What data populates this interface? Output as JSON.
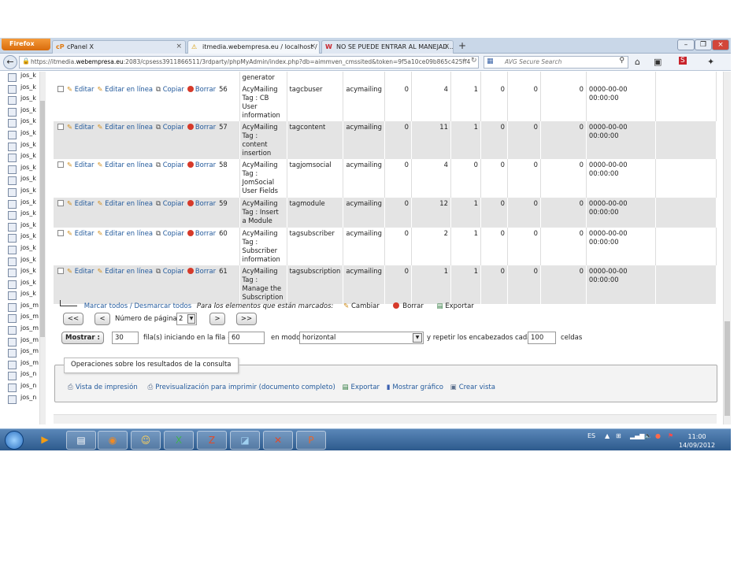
{
  "browser": {
    "menu_label": "Firefox",
    "tabs": [
      {
        "icon": "cP",
        "label": "cPanel X"
      },
      {
        "icon": "⚠",
        "label": "itmedia.webempresa.eu / localhost / ..."
      },
      {
        "icon": "W",
        "label": "NO SE PUEDE ENTRAR AL MANEJAD..."
      }
    ],
    "new_tab": "+",
    "url_prefix": "https://itmedia.",
    "url_domain": "webempresa.eu",
    "url_rest": ":2083/cpsess3911866511/3rdparty/phpMyAdmin/index.php?db=aimmven_cmssited&token=9f5a10ce09b865c425ff4",
    "search_placeholder": "AVG Secure Search"
  },
  "sidebar": {
    "items": [
      "jos_k",
      "jos_k",
      "jos_k",
      "jos_k",
      "jos_k",
      "jos_k",
      "jos_k",
      "jos_k",
      "jos_k",
      "jos_k",
      "jos_k",
      "jos_k",
      "jos_k",
      "jos_k",
      "jos_k",
      "jos_k",
      "jos_k",
      "jos_k",
      "jos_k",
      "jos_k",
      "jos_m",
      "jos_m",
      "jos_m",
      "jos_m",
      "jos_m",
      "jos_m",
      "jos_n",
      "jos_n",
      "jos_n"
    ]
  },
  "actions": {
    "edit": "Editar",
    "inline": "Editar en línea",
    "copy": "Copiar",
    "delete": "Borrar"
  },
  "top_partial": "generator",
  "rows": [
    {
      "id": "56",
      "name": "AcyMailing Tag : CB User information",
      "element": "tagcbuser",
      "folder": "acymailing",
      "c1": "0",
      "c2": "4",
      "c3": "1",
      "c4": "0",
      "c5": "0",
      "c6": "0",
      "date": "0000-00-00 00:00:00"
    },
    {
      "id": "57",
      "name": "AcyMailing Tag : content insertion",
      "element": "tagcontent",
      "folder": "acymailing",
      "c1": "0",
      "c2": "11",
      "c3": "1",
      "c4": "0",
      "c5": "0",
      "c6": "0",
      "date": "0000-00-00 00:00:00"
    },
    {
      "id": "58",
      "name": "AcyMailing Tag : JomSocial User Fields",
      "element": "tagjomsocial",
      "folder": "acymailing",
      "c1": "0",
      "c2": "4",
      "c3": "0",
      "c4": "0",
      "c5": "0",
      "c6": "0",
      "date": "0000-00-00 00:00:00"
    },
    {
      "id": "59",
      "name": "AcyMailing Tag : Insert a Module",
      "element": "tagmodule",
      "folder": "acymailing",
      "c1": "0",
      "c2": "12",
      "c3": "1",
      "c4": "0",
      "c5": "0",
      "c6": "0",
      "date": "0000-00-00 00:00:00"
    },
    {
      "id": "60",
      "name": "AcyMailing Tag : Subscriber information",
      "element": "tagsubscriber",
      "folder": "acymailing",
      "c1": "0",
      "c2": "2",
      "c3": "1",
      "c4": "0",
      "c5": "0",
      "c6": "0",
      "date": "0000-00-00 00:00:00"
    },
    {
      "id": "61",
      "name": "AcyMailing Tag : Manage the Subscription",
      "element": "tagsubscription",
      "folder": "acymailing",
      "c1": "0",
      "c2": "1",
      "c3": "1",
      "c4": "0",
      "c5": "0",
      "c6": "0",
      "date": "0000-00-00 00:00:00"
    }
  ],
  "bulk": {
    "check_all": "Marcar todos",
    "sep": " / ",
    "uncheck_all": "Desmarcar todos",
    "for_selected": "Para los elementos que están marcados:",
    "change": "Cambiar",
    "delete": "Borrar",
    "export": "Exportar"
  },
  "pager": {
    "first": "<<",
    "prev": "<",
    "page_label": "Número de página:",
    "page_value": "2",
    "next": ">",
    "last": ">>"
  },
  "show": {
    "button": "Mostrar :",
    "rows_value": "30",
    "rows_label": "fila(s) iniciando en la fila #",
    "start_value": "60",
    "mode_label": "en modo",
    "mode_value": "horizontal",
    "repeat_label": "y repetir los encabezados cada",
    "repeat_value": "100",
    "cells_label": "celdas"
  },
  "ops": {
    "legend": "Operaciones sobre los resultados de la consulta",
    "print_view": "Vista de impresión",
    "print_preview": "Previsualización para imprimir (documento completo)",
    "export": "Exportar",
    "chart": "Mostrar gráfico",
    "create_view": "Crear vista"
  },
  "taskbar": {
    "lang": "ES",
    "time": "11:00",
    "date": "14/09/2012"
  }
}
